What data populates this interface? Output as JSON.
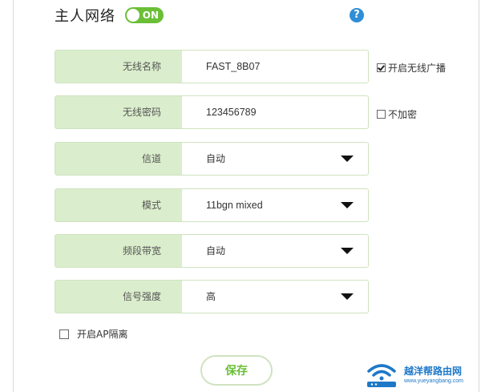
{
  "header": {
    "title": "主人网络",
    "toggle_label": "ON",
    "help_symbol": "?"
  },
  "form": {
    "rows": [
      {
        "label": "无线名称",
        "value": "FAST_8B07",
        "kind": "text"
      },
      {
        "label": "无线密码",
        "value": "123456789",
        "kind": "text"
      },
      {
        "label": "信道",
        "value": "自动",
        "kind": "select"
      },
      {
        "label": "模式",
        "value": "11bgn mixed",
        "kind": "select"
      },
      {
        "label": "频段带宽",
        "value": "自动",
        "kind": "select"
      },
      {
        "label": "信号强度",
        "value": "高",
        "kind": "select"
      }
    ],
    "broadcast": {
      "label": "开启无线广播",
      "checked": true
    },
    "no_encrypt": {
      "label": "不加密",
      "checked": false
    },
    "ap_isolation": {
      "label": "开启AP隔离",
      "checked": false
    },
    "save_label": "保存"
  },
  "watermark": {
    "name": "越洋帮路由网",
    "url": "www.yueyangbang.com"
  },
  "colors": {
    "accent_green": "#6abf37",
    "label_bg": "#daedcc",
    "help_blue": "#2f8fd6",
    "watermark_blue": "#1e78c8"
  },
  "icons": {
    "help": "help-icon",
    "dropdown": "dropdown-arrow-icon",
    "watermark": "wifi-router-logo-icon"
  }
}
